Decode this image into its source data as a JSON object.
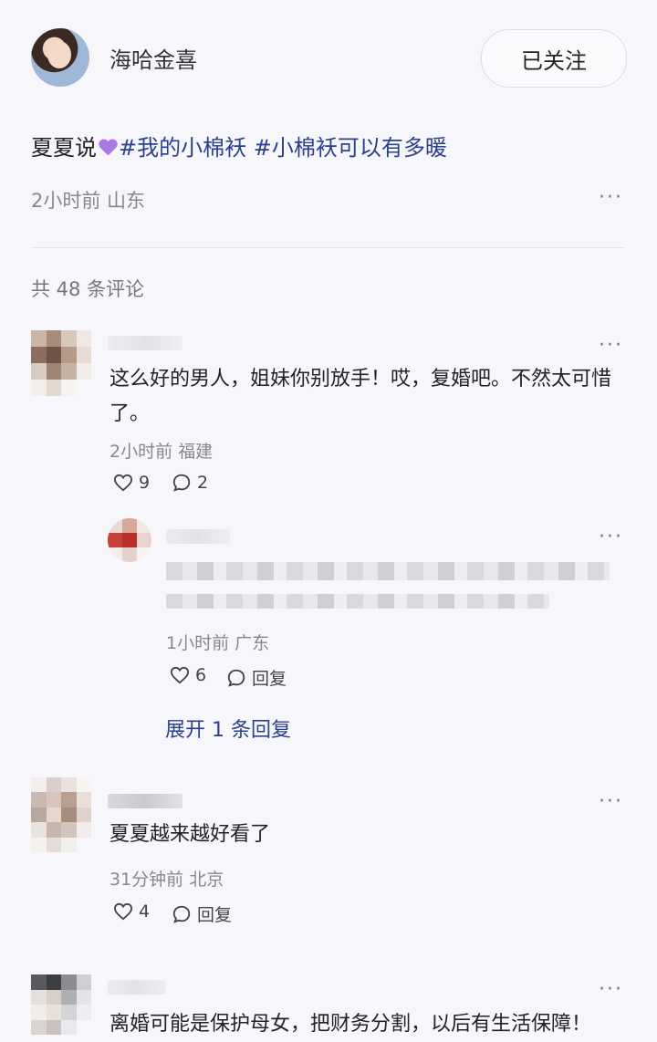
{
  "post": {
    "author": "海哈金喜",
    "follow_label": "已关注",
    "text_prefix": "夏夏说",
    "tag1": "#我的小棉袄",
    "tag2": "#小棉袄可以有多暖",
    "time_location": "2小时前 山东",
    "more": "···",
    "heart_emoji_color": "#a77be3"
  },
  "comments_header": "共 48 条评论",
  "comments": [
    {
      "text": "这么好的男人，姐妹你别放手！哎，复婚吧。不然太可惜了。",
      "meta": "2小时前 福建",
      "likes": "9",
      "replies": "2",
      "more": "···"
    },
    {
      "text": "夏夏越来越好看了",
      "meta": "31分钟前 北京",
      "likes": "4",
      "reply_label": "回复",
      "more": "···"
    },
    {
      "text": "离婚可能是保护母女，把财务分割，以后有生活保障！",
      "more": "···"
    }
  ],
  "reply": {
    "meta": "1小时前 广东",
    "likes": "6",
    "reply_label": "回复",
    "more": "···"
  },
  "expand_label": "展开 1 条回复",
  "colors": {
    "tag": "#2b3f8f",
    "meta": "#888888",
    "background": "#f7f7fb"
  }
}
